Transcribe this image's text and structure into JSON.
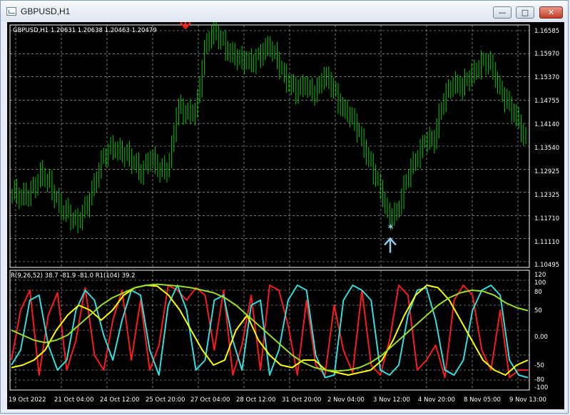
{
  "window": {
    "title": "GBPUSD,H1",
    "min_icon": "minimize-icon",
    "max_icon": "maximize-icon",
    "close_icon": "close-icon"
  },
  "chart": {
    "header": "GBPUSD,H1  1.20631 1.20638 1.20463 1.20479",
    "indicator_header": "R(9,26,52) 38.7 -81.9 -81.0  R1(104) 39.2",
    "price_labels": [
      "1.16585",
      "1.15970",
      "1.15370",
      "1.14755",
      "1.14140",
      "1.13540",
      "1.12925",
      "1.12325",
      "1.11710",
      "1.11110",
      "1.10495"
    ],
    "indicator_labels": [
      "120",
      "100",
      "80",
      "50",
      "0.00",
      "-50",
      "-80",
      "-100"
    ],
    "time_labels": [
      "19 Oct 2022",
      "21 Oct 04:00",
      "24 Oct 12:00",
      "25 Oct 20:00",
      "27 Oct 04:00",
      "28 Oct 12:00",
      "31 Oct 20:00",
      "2 Nov 04:00",
      "3 Nov 12:00",
      "4 Nov 20:00",
      "8 Nov 05:00",
      "9 Nov 13:00"
    ],
    "colors": {
      "candles": "#00c800",
      "grid": "#c8c8c8",
      "down_arrow": "#ff1a1a",
      "up_arrow": "#8ecbea",
      "rsi_red": "#ff1a1a",
      "rsi_cyan": "#33dddd",
      "rsi_yellow": "#ffff00",
      "rsi_green": "#9ade2a"
    }
  },
  "chart_data": {
    "type": "line",
    "price": {
      "ylim": [
        1.10495,
        1.16585
      ],
      "ticks": [
        1.16585,
        1.1597,
        1.1537,
        1.14755,
        1.1414,
        1.1354,
        1.12925,
        1.12325,
        1.1171,
        1.1111,
        1.10495
      ],
      "close": [
        1.123,
        1.121,
        1.124,
        1.128,
        1.125,
        1.121,
        1.118,
        1.114,
        1.12,
        1.126,
        1.132,
        1.136,
        1.134,
        1.131,
        1.129,
        1.133,
        1.128,
        1.13,
        1.146,
        1.143,
        1.145,
        1.162,
        1.165,
        1.163,
        1.16,
        1.157,
        1.158,
        1.16,
        1.161,
        1.158,
        1.153,
        1.149,
        1.152,
        1.15,
        1.153,
        1.151,
        1.146,
        1.142,
        1.138,
        1.132,
        1.124,
        1.117,
        1.119,
        1.126,
        1.132,
        1.138,
        1.136,
        1.148,
        1.153,
        1.15,
        1.154,
        1.158,
        1.157,
        1.151,
        1.148,
        1.142,
        1.136
      ]
    },
    "indicator": {
      "ylim": [
        -120,
        120
      ],
      "series": [
        {
          "name": "R(9,26,52)",
          "values": [
            -60,
            40,
            80,
            -90,
            30,
            75,
            -80,
            -20,
            85,
            -50,
            -80,
            20,
            80,
            -60,
            60,
            -80,
            -30,
            90,
            80,
            60,
            85,
            70,
            -40,
            80,
            -90,
            -30,
            70,
            -80,
            90,
            80,
            10,
            -90,
            60,
            -70,
            -90,
            50,
            -40,
            -85,
            80,
            -70,
            -90,
            -20,
            90,
            70,
            -80,
            -60,
            -30,
            -95,
            60,
            90,
            70,
            -40,
            -80,
            40,
            -95,
            -80,
            -80
          ]
        },
        {
          "name": "",
          "values": [
            -70,
            -40,
            60,
            70,
            -30,
            -80,
            -60,
            40,
            80,
            60,
            -10,
            -60,
            20,
            80,
            70,
            -40,
            -90,
            50,
            90,
            40,
            -80,
            -60,
            60,
            70,
            -20,
            -80,
            50,
            60,
            -90,
            -40,
            60,
            90,
            80,
            -50,
            -95,
            -90,
            60,
            90,
            80,
            60,
            -80,
            -90,
            -70,
            30,
            80,
            85,
            20,
            -80,
            -90,
            -60,
            40,
            80,
            90,
            70,
            -60,
            -90,
            -95
          ]
        },
        {
          "name": "",
          "values": [
            -75,
            -70,
            -60,
            -40,
            0,
            30,
            50,
            40,
            20,
            40,
            70,
            85,
            90,
            88,
            70,
            40,
            0,
            -40,
            -70,
            -60,
            0,
            30,
            -20,
            -50,
            -70,
            -75,
            -60,
            -60,
            -80,
            -85,
            -90,
            -85,
            -80,
            -60,
            -20,
            30,
            70,
            90,
            85,
            60,
            20,
            -20,
            -60,
            -80,
            -90,
            -70,
            -60
          ]
        },
        {
          "name": "R1(104)",
          "values": [
            0,
            -10,
            -20,
            -25,
            -20,
            -10,
            10,
            30,
            50,
            65,
            75,
            85,
            90,
            92,
            90,
            88,
            85,
            80,
            75,
            65,
            50,
            30,
            10,
            -10,
            -30,
            -50,
            -65,
            -75,
            -80,
            -82,
            -80,
            -75,
            -65,
            -50,
            -30,
            -10,
            10,
            30,
            50,
            65,
            75,
            80,
            78,
            70,
            55,
            45,
            39
          ]
        }
      ]
    }
  }
}
